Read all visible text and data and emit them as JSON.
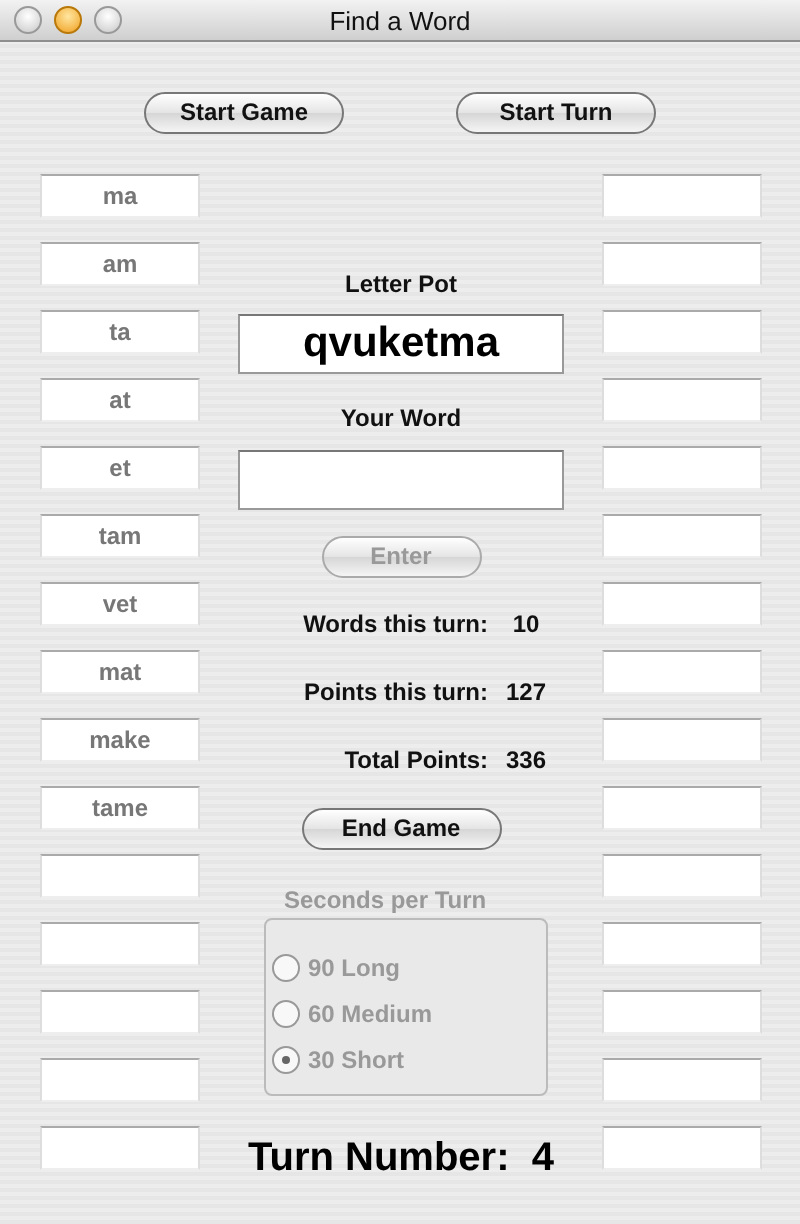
{
  "window": {
    "title": "Find a Word"
  },
  "buttons": {
    "start_game": {
      "label": "Start Game",
      "disabled": false
    },
    "start_turn": {
      "label": "Start Turn",
      "disabled": false
    }
  },
  "left_words": [
    {
      "kind": "word",
      "value": "ma"
    },
    {
      "kind": "word",
      "value": "am"
    },
    {
      "kind": "word",
      "value": "ta"
    },
    {
      "kind": "word",
      "value": "at"
    },
    {
      "kind": "word",
      "value": "et"
    },
    {
      "kind": "word",
      "value": "tam"
    },
    {
      "kind": "word",
      "value": "vet"
    },
    {
      "kind": "word",
      "value": "mat"
    },
    {
      "kind": "word",
      "value": "make"
    },
    {
      "kind": "word",
      "value": "tame"
    },
    {
      "kind": "empty"
    },
    {
      "kind": "empty"
    },
    {
      "kind": "empty"
    },
    {
      "kind": "empty"
    },
    {
      "kind": "empty"
    }
  ],
  "right_words": [
    {
      "kind": "empty"
    },
    {
      "kind": "empty"
    },
    {
      "kind": "empty"
    },
    {
      "kind": "empty"
    },
    {
      "kind": "empty"
    },
    {
      "kind": "empty"
    },
    {
      "kind": "empty"
    },
    {
      "kind": "empty"
    },
    {
      "kind": "empty"
    },
    {
      "kind": "empty"
    },
    {
      "kind": "empty"
    },
    {
      "kind": "empty"
    },
    {
      "kind": "empty"
    },
    {
      "kind": "empty"
    },
    {
      "kind": "empty"
    }
  ],
  "letter_pot": {
    "label": "Letter Pot",
    "value": "qvuketma"
  },
  "your_word": {
    "label": "Your Word"
  },
  "enter_button": {
    "label": "Enter",
    "disabled": true
  },
  "stats": [
    {
      "label": "Words this turn:",
      "value": "10"
    },
    {
      "label": "Points this turn:",
      "value": "127"
    },
    {
      "label": "Total Points:",
      "value": "336"
    }
  ],
  "end_game_button": {
    "label": "End Game",
    "disabled": false
  },
  "seconds_per_turn": {
    "label": "Seconds per Turn",
    "disabled": true,
    "options": [
      {
        "label": "90 Long",
        "selected": false
      },
      {
        "label": "60 Medium",
        "selected": false
      },
      {
        "label": "30 Short",
        "selected": true
      }
    ]
  },
  "turn_number": {
    "label": "Turn Number:",
    "value": "4"
  }
}
